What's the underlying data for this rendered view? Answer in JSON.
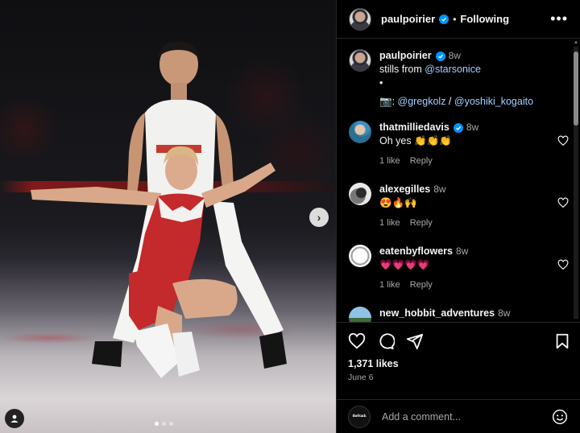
{
  "header": {
    "username": "paulpoirier",
    "separator": "•",
    "follow_state": "Following",
    "more_label": "•••"
  },
  "caption": {
    "username": "paulpoirier",
    "time": "8w",
    "line1_prefix": "stills from ",
    "line1_mention": "@starsonice",
    "line2": "•",
    "line3_prefix": "📷: ",
    "line3_mention1": "@gregkolz",
    "line3_sep": " / ",
    "line3_mention2": "@yoshiki_kogaito"
  },
  "comments": [
    {
      "username": "thatmilliedavis",
      "verified": true,
      "time": "8w",
      "text": "Oh yes 👏👏👏",
      "likes": "1 like",
      "reply": "Reply"
    },
    {
      "username": "alexegilles",
      "verified": false,
      "time": "8w",
      "text": "😍🔥🙌",
      "likes": "1 like",
      "reply": "Reply"
    },
    {
      "username": "eatenbyflowers",
      "verified": false,
      "time": "8w",
      "text": "💗💗💗💗",
      "likes": "1 like",
      "reply": "Reply"
    },
    {
      "username": "new_hobbit_adventures",
      "verified": false,
      "time": "8w",
      "text": "",
      "likes": "",
      "reply": ""
    }
  ],
  "actions": {
    "likes": "1,371 likes",
    "date": "June 6"
  },
  "add_comment": {
    "placeholder": "Add a comment...",
    "avatar_text": "theStack"
  },
  "colors": {
    "verified": "#0095f6",
    "mention": "#e0f1ff",
    "secondary_text": "#a8a8a8"
  }
}
